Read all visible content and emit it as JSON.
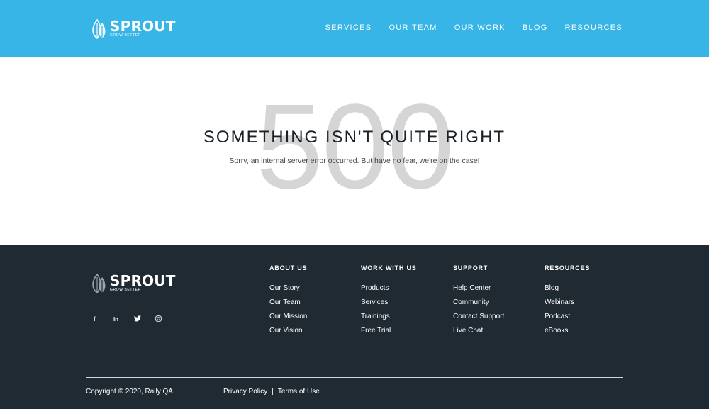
{
  "brand": {
    "name": "SPROUT",
    "tagline": "GROW BETTER",
    "accent_color": "#36b5e6",
    "footer_bg": "#1f2a33"
  },
  "nav": {
    "items": [
      "SERVICES",
      "OUR TEAM",
      "OUR WORK",
      "BLOG",
      "RESOURCES"
    ]
  },
  "error": {
    "code": "500",
    "title": "SOMETHING ISN'T QUITE RIGHT",
    "message": "Sorry, an internal server error occurred. But have no fear, we're on the case!"
  },
  "footer": {
    "social": [
      {
        "icon": "facebook-icon",
        "glyph": "f"
      },
      {
        "icon": "linkedin-icon",
        "glyph": "in"
      },
      {
        "icon": "twitter-icon",
        "glyph": "🐦"
      },
      {
        "icon": "instagram-icon",
        "glyph": "◎"
      }
    ],
    "columns": [
      {
        "heading": "ABOUT US",
        "links": [
          "Our Story",
          "Our Team",
          "Our Mission",
          "Our Vision"
        ]
      },
      {
        "heading": "WORK WITH US",
        "links": [
          "Products",
          "Services",
          "Trainings",
          "Free Trial"
        ]
      },
      {
        "heading": "SUPPORT",
        "links": [
          "Help Center",
          "Community",
          "Contact Support",
          "Live Chat"
        ]
      },
      {
        "heading": "RESOURCES",
        "links": [
          "Blog",
          "Webinars",
          "Podcast",
          "eBooks"
        ]
      }
    ],
    "copyright": "Copyright © 2020, Rally QA",
    "legal": {
      "privacy": "Privacy Policy",
      "separator": "|",
      "terms": "Terms of Use"
    }
  }
}
